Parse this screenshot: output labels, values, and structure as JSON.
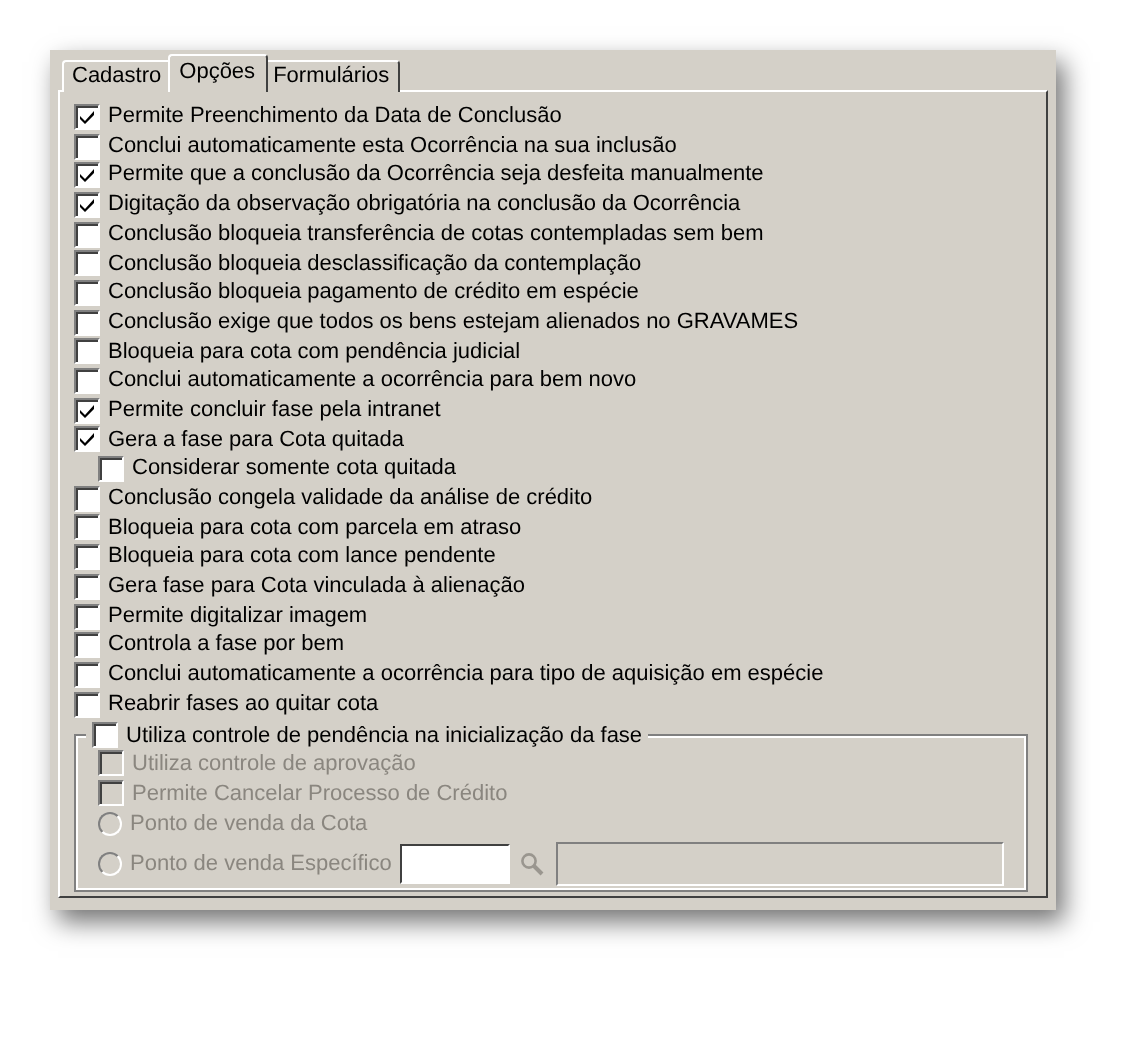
{
  "tabs": [
    {
      "label": "Cadastro",
      "selected": false
    },
    {
      "label": "Opções",
      "selected": true
    },
    {
      "label": "Formulários",
      "selected": false
    }
  ],
  "options": [
    {
      "label": "Permite Preenchimento da Data de Conclusão",
      "checked": true
    },
    {
      "label": "Conclui automaticamente esta Ocorrência na sua inclusão",
      "checked": false
    },
    {
      "label": "Permite que a conclusão da Ocorrência seja desfeita manualmente",
      "checked": true
    },
    {
      "label": "Digitação da observação obrigatória na conclusão da Ocorrência",
      "checked": true
    },
    {
      "label": "Conclusão bloqueia transferência de cotas contempladas sem bem",
      "checked": false
    },
    {
      "label": "Conclusão bloqueia desclassificação da contemplação",
      "checked": false
    },
    {
      "label": "Conclusão bloqueia pagamento de crédito em espécie",
      "checked": false
    },
    {
      "label": "Conclusão exige que todos os bens estejam alienados no GRAVAMES",
      "checked": false
    },
    {
      "label": "Bloqueia para cota com pendência judicial",
      "checked": false
    },
    {
      "label": "Conclui automaticamente a ocorrência para bem novo",
      "checked": false
    },
    {
      "label": "Permite concluir fase pela intranet",
      "checked": true
    },
    {
      "label": "Gera a fase para Cota quitada",
      "checked": true,
      "children": [
        {
          "label": "Considerar somente cota quitada",
          "checked": false
        }
      ]
    },
    {
      "label": "Conclusão congela validade da análise de crédito",
      "checked": false
    },
    {
      "label": "Bloqueia para cota com parcela em atraso",
      "checked": false
    },
    {
      "label": "Bloqueia para cota com lance pendente",
      "checked": false
    },
    {
      "label": "Gera fase para Cota vinculada à alienação",
      "checked": false
    },
    {
      "label": "Permite digitalizar imagem",
      "checked": false
    },
    {
      "label": "Controla a fase por bem",
      "checked": false
    },
    {
      "label": "Conclui automaticamente a ocorrência para tipo de aquisição em espécie",
      "checked": false
    },
    {
      "label": "Reabrir fases ao quitar cota",
      "checked": false
    }
  ],
  "pending_group": {
    "label": "Utiliza controle de pendência na inicialização da fase",
    "checked": false,
    "items": [
      {
        "kind": "checkbox",
        "label": "Utiliza controle de aprovação",
        "checked": false,
        "disabled": true
      },
      {
        "kind": "checkbox",
        "label": "Permite Cancelar Processo de Crédito",
        "checked": false,
        "disabled": true
      },
      {
        "kind": "radio",
        "label": "Ponto de venda da Cota",
        "selected": false,
        "disabled": true
      },
      {
        "kind": "radio_lookup",
        "label": "Ponto de venda Específico",
        "selected": false,
        "disabled": true
      }
    ]
  }
}
